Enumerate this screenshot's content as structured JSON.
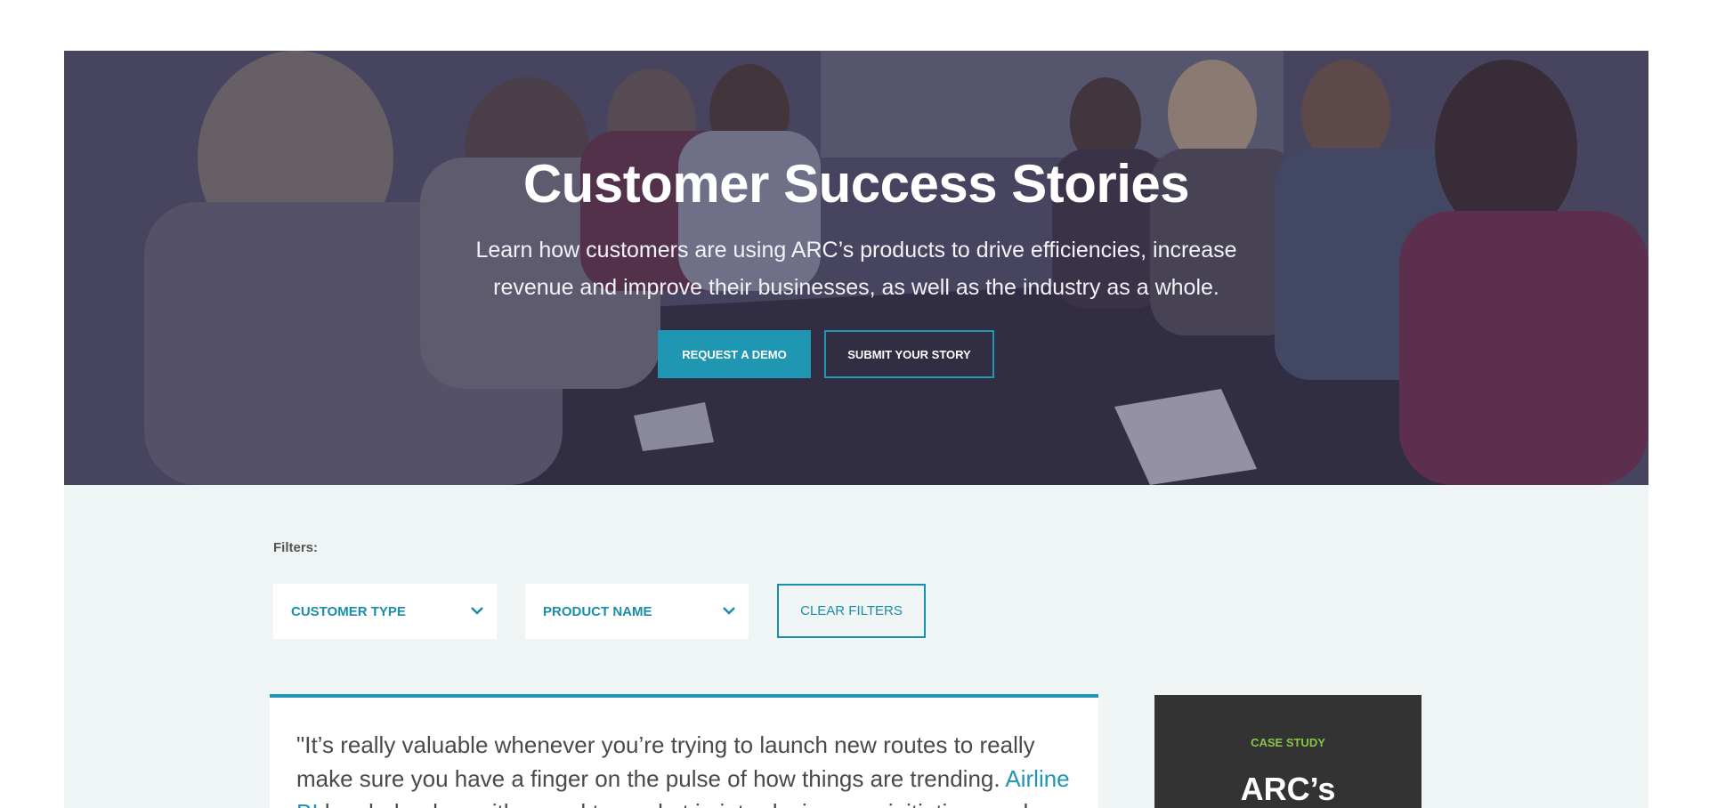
{
  "hero": {
    "title": "Customer Success Stories",
    "subtitle": "Learn how customers are using ARC’s products to drive efficiencies, increase revenue and improve their businesses, as well as the industry as a whole.",
    "request_demo_label": "REQUEST A DEMO",
    "submit_story_label": "SUBMIT YOUR STORY"
  },
  "filters": {
    "label": "Filters:",
    "customer_type": "CUSTOMER TYPE",
    "product_name": "PRODUCT NAME",
    "clear_label": "CLEAR FILTERS"
  },
  "quote": {
    "text_before": "\"It’s really valuable whenever you’re trying to launch new routes to really make sure you have a finger on the pulse of how things are trending. ",
    "link_text": "Airline BI",
    "text_after": " has helped us with speed to market in introducing new initiatives and"
  },
  "case_study": {
    "label": "CASE STUDY",
    "title": "ARC’s"
  },
  "colors": {
    "accent": "#1f97b2",
    "case_label": "#8bc34a",
    "card_dark": "#333333",
    "section_bg": "#eff5f5"
  }
}
